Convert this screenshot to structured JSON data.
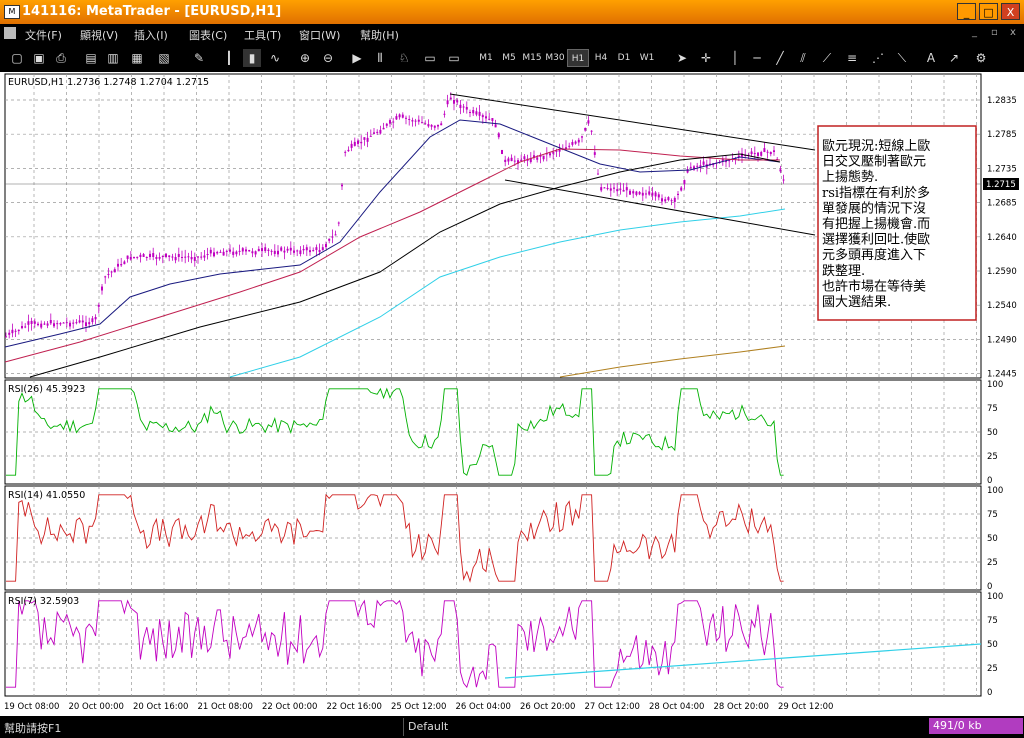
{
  "window": {
    "title": "141116: MetaTrader - [EURUSD,H1]",
    "controls": [
      "_",
      "□",
      "X"
    ],
    "mdi_controls": [
      "_",
      "▫",
      "x"
    ]
  },
  "menu": [
    "文件(F)",
    "顯視(V)",
    "插入(I)",
    "圖表(C)",
    "工具(T)",
    "窗口(W)",
    "幫助(H)"
  ],
  "toolbar": {
    "timeframes": [
      "M1",
      "M5",
      "M15",
      "M30",
      "H1",
      "H4",
      "D1",
      "W1"
    ],
    "selected": "H1"
  },
  "main_panel": {
    "label": "EURUSD,H1  1.2736 1.2748 1.2704 1.2715",
    "price_labels": [
      "1.2835",
      "1.2785",
      "1.2735",
      "1.2685",
      "1.2640",
      "1.2590",
      "1.2540",
      "1.2490",
      "1.2445"
    ],
    "current_price": "1.2715"
  },
  "rsi_panels": [
    {
      "label": "RSI(26)  45.3923",
      "color": "#00b000",
      "levels": [
        "100",
        "75",
        "50",
        "25",
        "0"
      ]
    },
    {
      "label": "RSI(14)  41.0550",
      "color": "#d02020",
      "levels": [
        "100",
        "75",
        "50",
        "25",
        "0"
      ]
    },
    {
      "label": "RSI(7)  32.5903",
      "color": "#c000c0",
      "levels": [
        "100",
        "75",
        "50",
        "25",
        "0"
      ]
    }
  ],
  "time_labels": [
    "19 Oct 08:00",
    "20 Oct 00:00",
    "20 Oct 16:00",
    "21 Oct 08:00",
    "22 Oct 00:00",
    "22 Oct 16:00",
    "25 Oct 12:00",
    "26 Oct 04:00",
    "26 Oct 20:00",
    "27 Oct 12:00",
    "28 Oct 04:00",
    "28 Oct 20:00",
    "29 Oct 12:00"
  ],
  "annotation": [
    "歐元現況:短線上歐",
    "日交叉壓制著歐元",
    "上揚態勢.",
    " rsi指標在有利於多",
    "單發展的情況下沒",
    "有把握上揚機會.而",
    "選擇獲利回吐.使歐",
    "元多頭再度進入下",
    "跌整理.",
    "也許市場在等待美",
    "國大選結果."
  ],
  "colors": {
    "candles": "#c000c0",
    "ma_fast": "#1a1a80",
    "ma_mid": "#c02050",
    "ma_slow": "#000000",
    "ma_cyan": "#30d0e8",
    "ma_gold": "#b08020",
    "trendline": "#30d0e8",
    "status_kb_bg": "#b13cc0"
  },
  "statusbar": {
    "help": "幫助請按F1",
    "profile": "Default",
    "kb": "491/0 kb"
  }
}
